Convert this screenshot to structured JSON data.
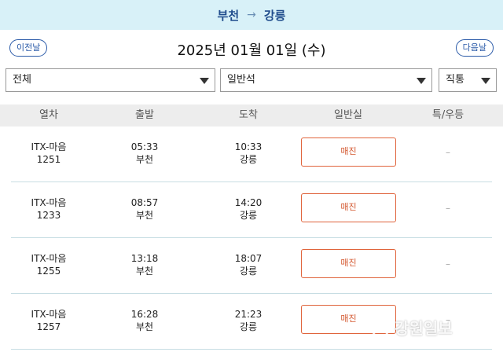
{
  "route": {
    "from": "부천",
    "arrow": "→",
    "to": "강릉"
  },
  "date_nav": {
    "prev_label": "이전날",
    "date": "2025년 01월 01일 (수)",
    "next_label": "다음날"
  },
  "filters": {
    "train_type": "전체",
    "seat_type": "일반석",
    "route_type": "직통"
  },
  "columns": [
    "열차",
    "출발",
    "도착",
    "일반실",
    "특/우등"
  ],
  "trains": [
    {
      "name": "ITX-마음",
      "number": "1251",
      "dep_time": "05:33",
      "dep_station": "부천",
      "arr_time": "10:33",
      "arr_station": "강릉",
      "general": "매진",
      "special": "–"
    },
    {
      "name": "ITX-마음",
      "number": "1233",
      "dep_time": "08:57",
      "dep_station": "부천",
      "arr_time": "14:20",
      "arr_station": "강릉",
      "general": "매진",
      "special": "–"
    },
    {
      "name": "ITX-마음",
      "number": "1255",
      "dep_time": "13:18",
      "dep_station": "부천",
      "arr_time": "18:07",
      "arr_station": "강릉",
      "general": "매진",
      "special": "–"
    },
    {
      "name": "ITX-마음",
      "number": "1257",
      "dep_time": "16:28",
      "dep_station": "부천",
      "arr_time": "21:23",
      "arr_station": "강릉",
      "general": "매진",
      "special": "–"
    }
  ],
  "watermark": {
    "text": "강원일보"
  },
  "colors": {
    "accent": "#2a5aa8",
    "soldout": "#e0643c",
    "route_bg": "#d8f1f8"
  }
}
